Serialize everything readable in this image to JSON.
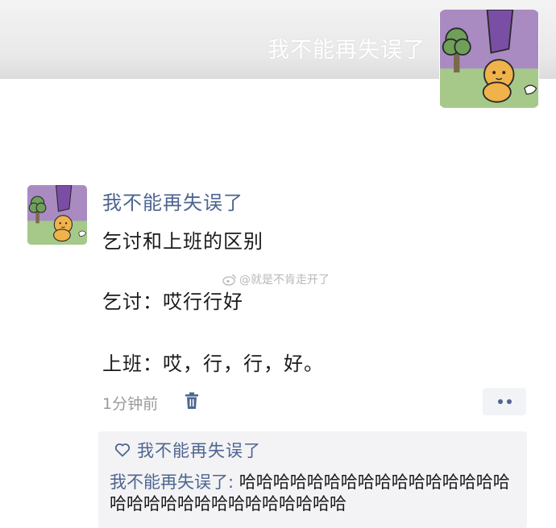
{
  "header": {
    "name": "我不能再失误了"
  },
  "post": {
    "author": "我不能再失误了",
    "line1": "乞讨和上班的区别",
    "line2": "乞讨：哎行行好",
    "line3": "上班：哎，行，行，好。",
    "watermark": "@就是不肯走开了",
    "time": "1分钟前"
  },
  "interactions": {
    "like_name": "我不能再失误了",
    "comment_author": "我不能再失误了:",
    "comment_text": " 哈哈哈哈哈哈哈哈哈哈哈哈哈哈哈哈哈哈哈哈哈哈哈哈哈哈哈哈哈哈"
  },
  "colors": {
    "link": "#4e6590",
    "text": "#1a1a1a",
    "muted": "#9a9a9a",
    "avatar_bg_sky": "#a98bc2",
    "avatar_bg_grass": "#a6c98a",
    "character": "#f0b24a"
  },
  "icons": [
    "weibo-icon",
    "trash-icon",
    "heart-outline-icon",
    "more-dots-icon"
  ]
}
